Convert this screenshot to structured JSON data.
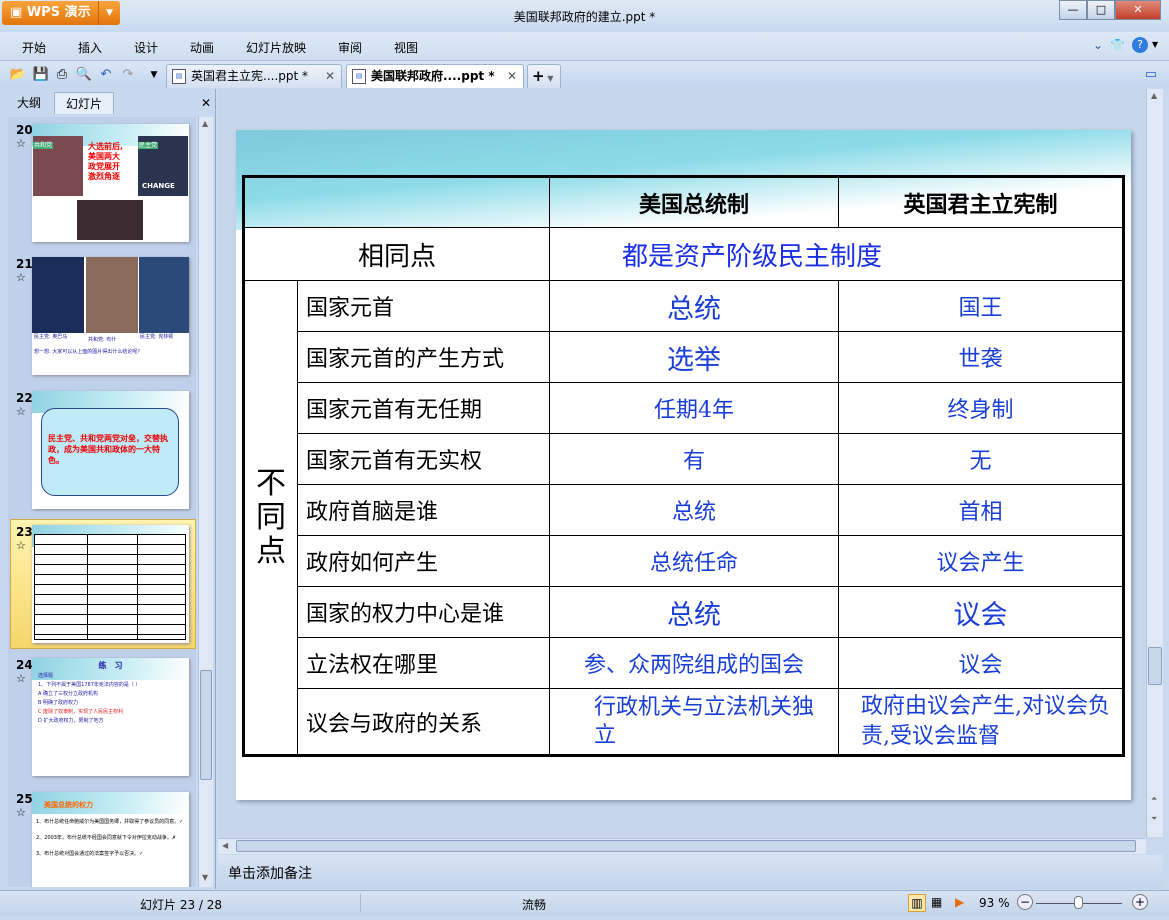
{
  "app": {
    "name": "WPS 演示",
    "window_title": "美国联邦政府的建立.ppt *"
  },
  "menu": [
    "开始",
    "插入",
    "设计",
    "动画",
    "幻灯片放映",
    "审阅",
    "视图"
  ],
  "doc_tabs": [
    {
      "label": "英国君主立宪....ppt *"
    },
    {
      "label": "美国联邦政府....ppt *",
      "active": true
    }
  ],
  "panel": {
    "tabs": [
      "大纲",
      "幻灯片"
    ],
    "active": "幻灯片"
  },
  "thumbnails": [
    {
      "num": "20",
      "lines": [
        "大选前后,",
        "美国两大",
        "政党展开",
        "激烈角逐"
      ],
      "labels": [
        "共和党",
        "民主党",
        "CHANGE"
      ]
    },
    {
      "num": "21",
      "labels": [
        "民主党: 奥巴马",
        "共和党: 布什",
        "民主党: 克林顿"
      ],
      "caption": "想一想: 大家可以从上面的图片得出什么结论呢?"
    },
    {
      "num": "22",
      "text": "民主党、共和党两党对垒，交替执政，成为美国共和政体的一大特色。"
    },
    {
      "num": "23",
      "selected": true
    },
    {
      "num": "24",
      "title": "练　习",
      "lines": [
        "选择题",
        "1、下列不属于美国1787年宪法内容的是（ ）",
        "A 确立了三权分立政府机构",
        "B 明确了政府权力",
        "C 废除了奴隶制，实现了人民民主权利",
        "D 扩大政府权力，限制了地方"
      ]
    },
    {
      "num": "25",
      "title": "美国总统的权力",
      "lines": [
        "1、布什总统任命鲍威尔为美国国务卿，并取得了参议员的同意。✓",
        "2、2003年，布什总统不经国会同意就下令对伊拉克动战争。✗",
        "3、布什总统对国会通过的法案签字予以否决。✓"
      ]
    }
  ],
  "slide": {
    "header": [
      "",
      "美国总统制",
      "英国君主立宪制"
    ],
    "same_label": "相同点",
    "same_value": "都是资产阶级民主制度",
    "diff_label": "不同点",
    "rows": [
      {
        "item": "国家元首",
        "us": "总统",
        "uk": "国王"
      },
      {
        "item": "国家元首的产生方式",
        "us": "选举",
        "uk": "世袭"
      },
      {
        "item": "国家元首有无任期",
        "us": "任期4年",
        "uk": "终身制"
      },
      {
        "item": "国家元首有无实权",
        "us": "有",
        "uk": "无"
      },
      {
        "item": "政府首脑是谁",
        "us": "总统",
        "uk": "首相"
      },
      {
        "item": "政府如何产生",
        "us": "总统任命",
        "uk": "议会产生"
      },
      {
        "item": "国家的权力中心是谁",
        "us": "总统",
        "uk": "议会"
      },
      {
        "item": "立法权在哪里",
        "us": "参、众两院组成的国会",
        "uk": "议会"
      },
      {
        "item": "议会与政府的关系",
        "us": "行政机关与立法机关独立",
        "uk": "政府由议会产生,对议会负责,受议会监督"
      }
    ]
  },
  "notes_placeholder": "单击添加备注",
  "status": {
    "slide": "幻灯片 23 / 28",
    "theme": "流畅",
    "zoom": "93 %",
    "zoom_level": 0.93
  }
}
